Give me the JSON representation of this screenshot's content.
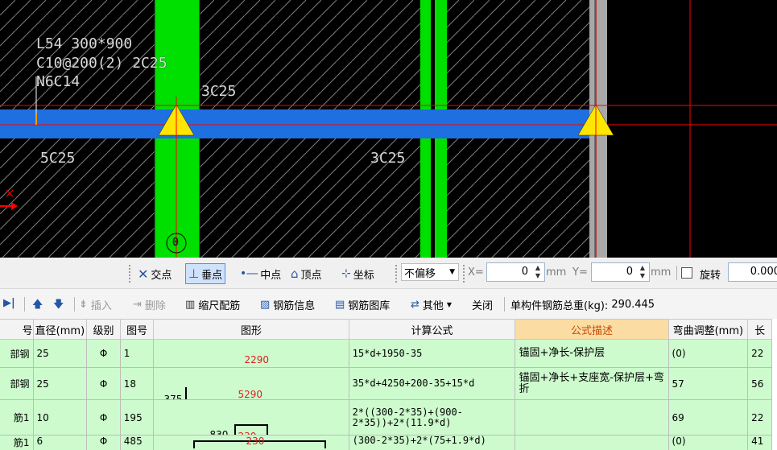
{
  "canvas": {
    "beam_label": "L54 300*900",
    "stirrup_label": "C10@200(2) 2C25",
    "side_bar_label": "N6C14",
    "top_bar_left": "3C25",
    "bottom_bar_left": "5C25",
    "bottom_bar_right": "3C25",
    "column_marker": "0",
    "colors": {
      "beam": "#1e6fe0",
      "column": "#00e000",
      "crosshair": "#ff0000",
      "support": "#ffe600"
    }
  },
  "snap_toolbar": {
    "intersection": "交点",
    "perpendicular": "垂点",
    "midpoint": "中点",
    "vertex": "顶点",
    "coordinate": "坐标",
    "offset_option": "不偏移",
    "x_label": "X=",
    "x_value": "0",
    "x_unit": "mm",
    "y_label": "Y=",
    "y_value": "0",
    "y_unit": "mm",
    "rotate_label": "旋转",
    "rotate_value": "0.000"
  },
  "rebar_toolbar": {
    "insert": "插入",
    "delete": "删除",
    "scale_config": "缩尺配筋",
    "rebar_info": "钢筋信息",
    "rebar_library": "钢筋图库",
    "other": "其他",
    "close": "关闭",
    "total_weight_label": "单构件钢筋总重(kg):",
    "total_weight_value": "290.445"
  },
  "table": {
    "headers": [
      "号",
      "直径(mm)",
      "级别",
      "图号",
      "图形",
      "计算公式",
      "公式描述",
      "弯曲调整(mm)",
      "长"
    ],
    "rows": [
      {
        "name": "部钢",
        "diameter": "25",
        "grade": "Φ",
        "fig": "1",
        "shape_value": "2290",
        "shape_left": "",
        "formula": "15*d+1950-35",
        "desc": "锚固+净长-保护层",
        "bend": "(0)",
        "len": "22"
      },
      {
        "name": "部钢",
        "diameter": "25",
        "grade": "Φ",
        "fig": "18",
        "shape_value": "5290",
        "shape_left": "375",
        "formula": "35*d+4250+200-35+15*d",
        "desc": "锚固+净长+支座宽-保护层+弯折",
        "bend": "57",
        "len": "56"
      },
      {
        "name": "筋1",
        "diameter": "10",
        "grade": "Φ",
        "fig": "195",
        "shape_value": "230",
        "shape_left": "830",
        "formula": "2*((300-2*35)+(900-2*35))+2*(11.9*d)",
        "desc": "",
        "bend": "69",
        "len": "22"
      },
      {
        "name": "筋1",
        "diameter": "6",
        "grade": "Φ",
        "fig": "485",
        "shape_value": "230",
        "shape_left": "",
        "formula": "(300-2*35)+2*(75+1.9*d)",
        "desc": "",
        "bend": "(0)",
        "len": "41"
      }
    ]
  }
}
